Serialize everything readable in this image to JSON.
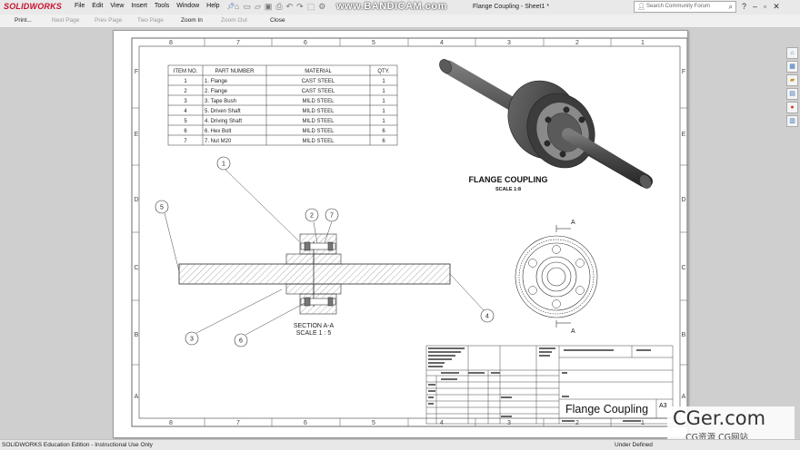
{
  "app": {
    "logo": "SOLIDWORKS",
    "document_title": "Flange Coupling - Sheet1 *",
    "recorder_watermark": "www.BANDICAM.com"
  },
  "menu": [
    "File",
    "Edit",
    "View",
    "Insert",
    "Tools",
    "Window",
    "Help"
  ],
  "search": {
    "placeholder": "Search Community Forum"
  },
  "window_controls": {
    "help": "?",
    "minimize": "–",
    "restore": "▫",
    "close": "✕"
  },
  "print_preview_toolbar": [
    "Print...",
    "Next Page",
    "Prev Page",
    "Two Page",
    "Zoom In",
    "Zoom Out",
    "Close"
  ],
  "border": {
    "columns_top": [
      "8",
      "7",
      "6",
      "5",
      "4",
      "3",
      "2",
      "1"
    ],
    "rows_left": [
      "F",
      "E",
      "D",
      "C",
      "B",
      "A"
    ]
  },
  "bom": {
    "headers": [
      "ITEM NO.",
      "PART NUMBER",
      "MATERIAL",
      "QTY."
    ],
    "rows": [
      [
        "1",
        "1. Flange",
        "CAST STEEL",
        "1"
      ],
      [
        "2",
        "2. Flange",
        "CAST STEEL",
        "1"
      ],
      [
        "3",
        "3. Tape Bush",
        "MILD STEEL",
        "1"
      ],
      [
        "4",
        "5. Driven Shaft",
        "MILD STEEL",
        "1"
      ],
      [
        "5",
        "4. Driving Shaft",
        "MILD STEEL",
        "1"
      ],
      [
        "6",
        "6. Hex Bolt",
        "MILD STEEL",
        "6"
      ],
      [
        "7",
        "7. Nut M20",
        "MILD STEEL",
        "6"
      ]
    ]
  },
  "iso_view": {
    "title": "FLANGE COUPLING",
    "scale": "SCALE 1:8"
  },
  "section_view": {
    "title": "SECTION A-A",
    "scale": "SCALE 1 : 5"
  },
  "section_marker": "A",
  "balloons": [
    "1",
    "2",
    "7",
    "5",
    "3",
    "6",
    "4"
  ],
  "title_block": {
    "drawing_title": "Flange Coupling",
    "size": "A3",
    "small_dwg_no": "DWG. NO.",
    "small_scale": "SCALE:1:5",
    "small_sheet": "SHEET 1 OF 1"
  },
  "status": {
    "left": "SOLIDWORKS Education Edition - Instructional Use Only",
    "right": "Under Defined"
  },
  "watermark": {
    "big": "CGer.com",
    "small": "CG资源 CG网站"
  },
  "sidebar_icons": [
    "home-icon",
    "parts-icon",
    "folder-icon",
    "appearance-icon",
    "palette-icon",
    "properties-icon"
  ]
}
